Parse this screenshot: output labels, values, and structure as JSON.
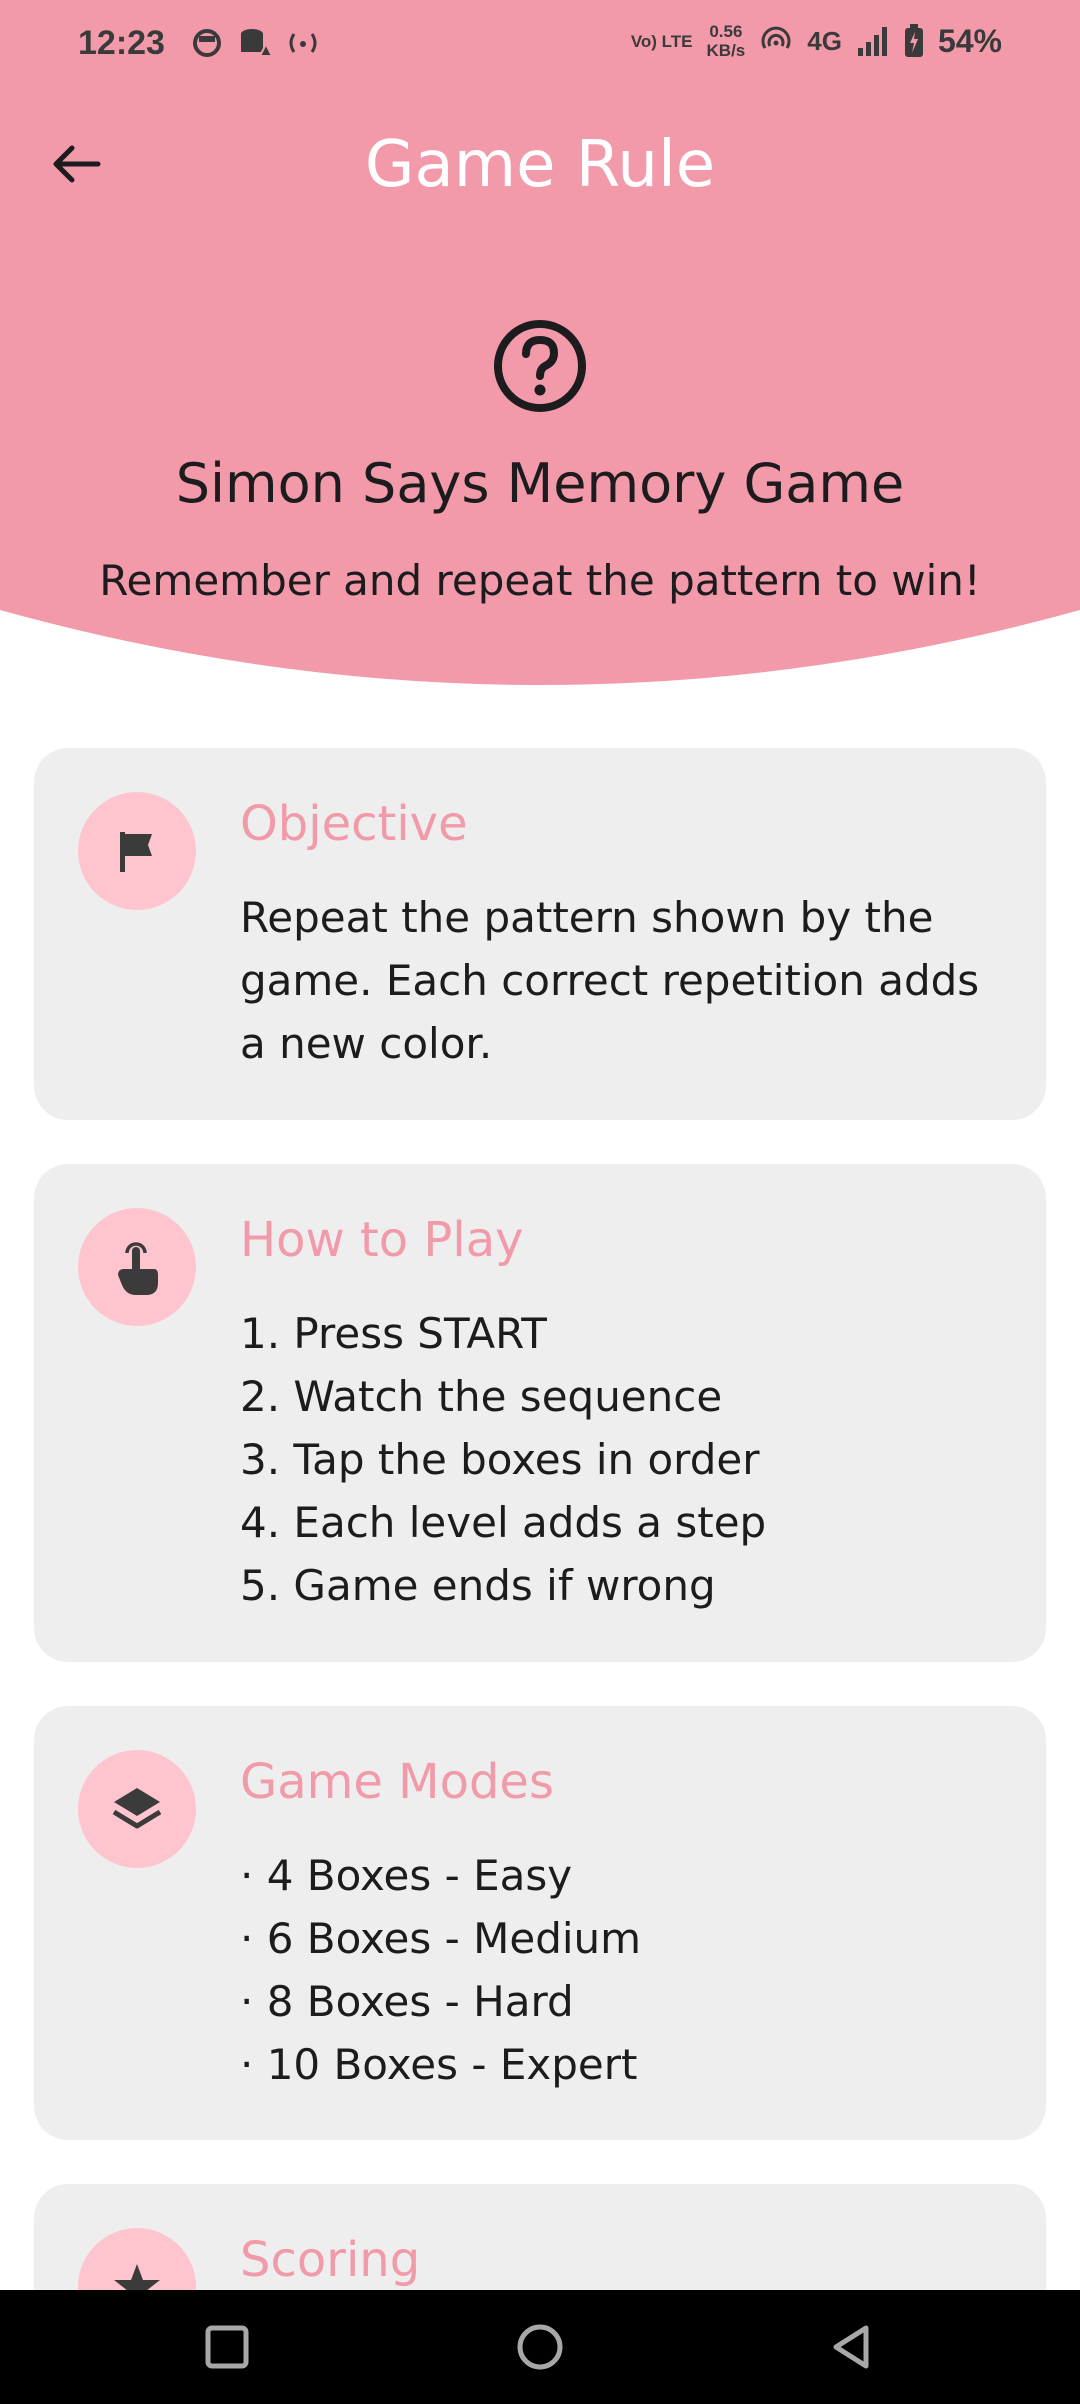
{
  "colors": {
    "header_pink": "#f39aaa",
    "accent_pink": "#f19aa9",
    "icon_circle": "#ffc5cf",
    "card_bg": "#eeeeee",
    "nav_bg": "#000000"
  },
  "status_bar": {
    "time": "12:23",
    "network_speed_value": "0.56",
    "network_speed_unit": "KB/s",
    "network_type": "4G",
    "volte": "Vo) LTE",
    "battery": "54%"
  },
  "header": {
    "title": "Game Rule",
    "back_icon": "arrow-left-icon",
    "help_icon": "question-circle-icon",
    "game_name": "Simon Says Memory Game",
    "tagline": "Remember and repeat the pattern to win!"
  },
  "cards": [
    {
      "icon": "flag-icon",
      "title": "Objective",
      "body": "Repeat the pattern shown by the game. Each correct repetition adds a new color."
    },
    {
      "icon": "tap-hand-icon",
      "title": "How to Play",
      "lines": [
        "1. Press START",
        "2. Watch the sequence",
        "3. Tap the boxes in order",
        "4. Each level adds a step",
        "5. Game ends if wrong"
      ]
    },
    {
      "icon": "layers-icon",
      "title": "Game Modes",
      "lines": [
        "· 4 Boxes - Easy",
        "· 6 Boxes - Medium",
        "· 8 Boxes - Hard",
        "· 10 Boxes - Expert"
      ]
    },
    {
      "icon": "star-icon",
      "title": "Scoring"
    }
  ],
  "nav_bar": {
    "recents_icon": "square-recents-icon",
    "home_icon": "circle-home-icon",
    "back_icon": "triangle-back-icon"
  }
}
